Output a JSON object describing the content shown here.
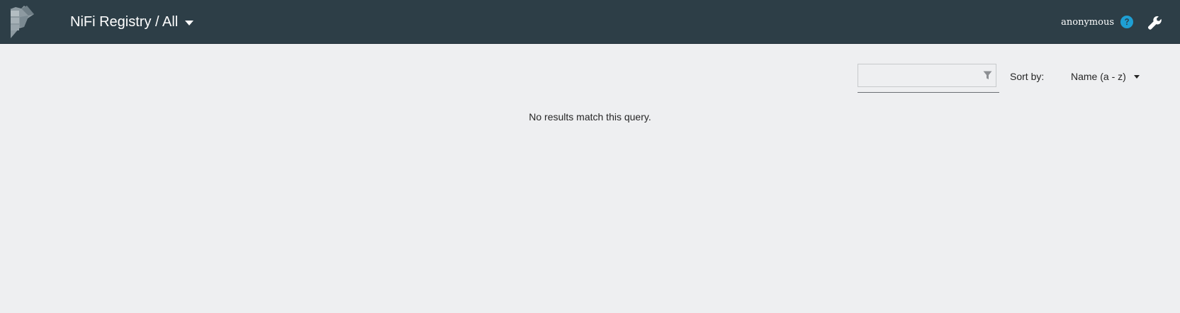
{
  "header": {
    "title": "NiFi Registry / All",
    "user": "anonymous",
    "colors": {
      "background": "#2d3e47",
      "help_accent": "#1e9fd4"
    },
    "icons": [
      "nifi-registry-logo",
      "chevron-down-icon",
      "help-icon",
      "wrench-icon"
    ]
  },
  "toolbar": {
    "filter": {
      "value": "",
      "placeholder": ""
    },
    "sort_label": "Sort by:",
    "sort_value": "Name (a - z)"
  },
  "main": {
    "empty_message": "No results match this query."
  }
}
